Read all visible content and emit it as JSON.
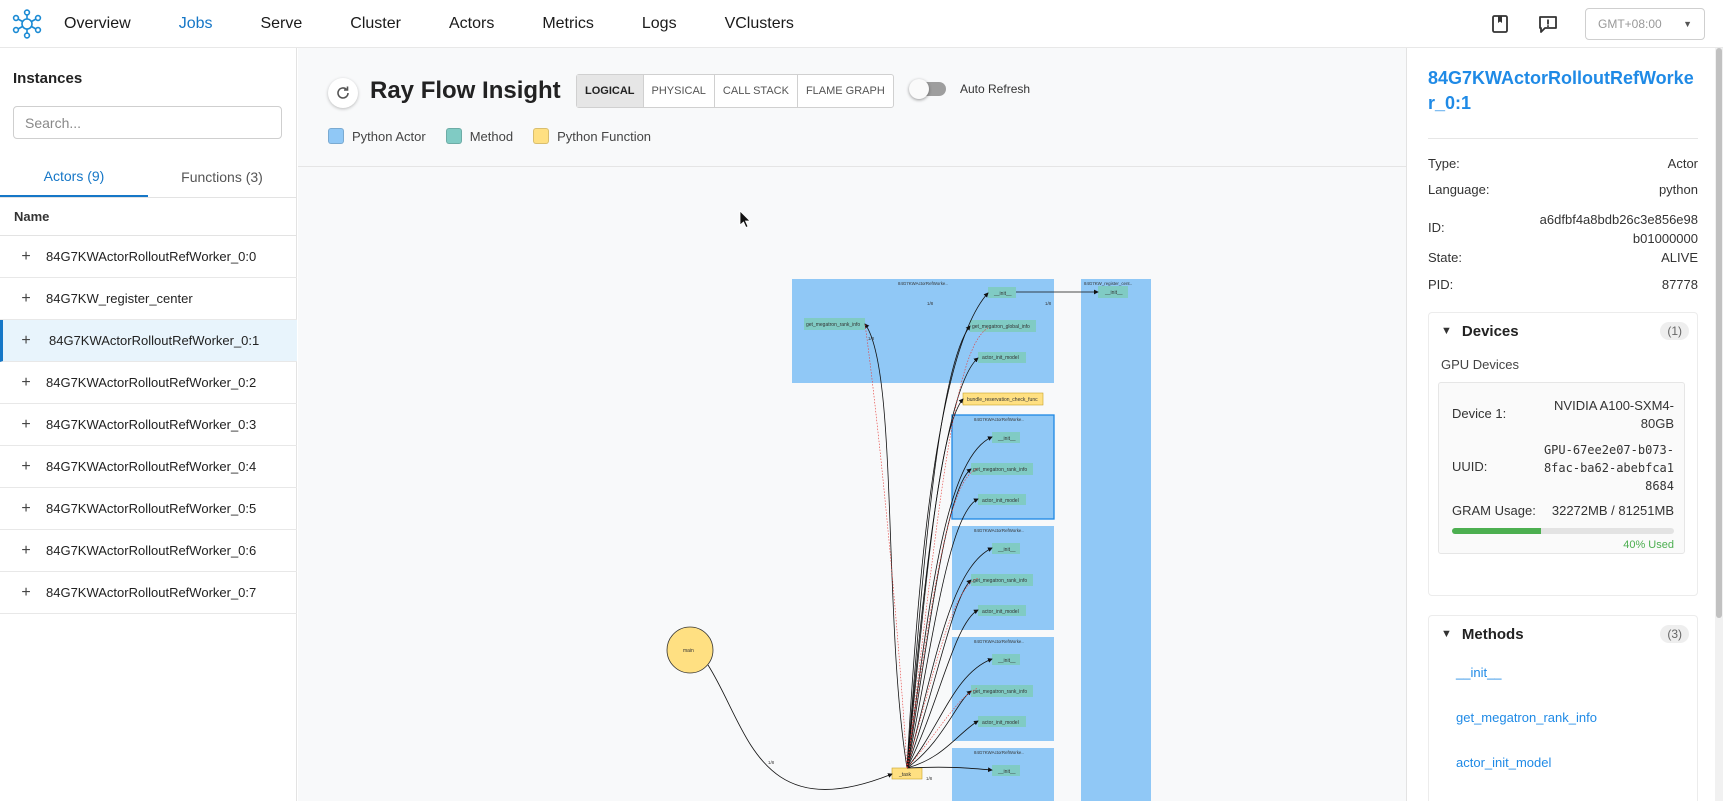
{
  "nav": {
    "items": [
      "Overview",
      "Jobs",
      "Serve",
      "Cluster",
      "Actors",
      "Metrics",
      "Logs",
      "VClusters"
    ],
    "active": "Jobs",
    "timezone": "GMT+08:00"
  },
  "sidebar": {
    "title": "Instances",
    "search_placeholder": "Search...",
    "tabs": [
      "Actors (9)",
      "Functions (3)"
    ],
    "column_header": "Name",
    "items": [
      "84G7KWActorRolloutRefWorker_0:0",
      "84G7KW_register_center",
      "84G7KWActorRolloutRefWorker_0:1",
      "84G7KWActorRolloutRefWorker_0:2",
      "84G7KWActorRolloutRefWorker_0:3",
      "84G7KWActorRolloutRefWorker_0:4",
      "84G7KWActorRolloutRefWorker_0:5",
      "84G7KWActorRolloutRefWorker_0:6",
      "84G7KWActorRolloutRefWorker_0:7"
    ],
    "selected_index": 2
  },
  "main": {
    "title": "Ray Flow Insight",
    "views": [
      "LOGICAL",
      "PHYSICAL",
      "CALL STACK",
      "FLAME GRAPH"
    ],
    "active_view": "LOGICAL",
    "auto_refresh_label": "Auto Refresh",
    "legend": [
      {
        "label": "Python Actor",
        "color": "#90c8f6"
      },
      {
        "label": "Method",
        "color": "#80cbc4"
      },
      {
        "label": "Python Function",
        "color": "#ffe082"
      }
    ]
  },
  "graph": {
    "main_node": "main",
    "actor_top_label": "84G7KWActorRefWorke..",
    "register_label": "84G7KW_register_cent..",
    "actor_label": "84G7KWActorRefWorke..",
    "methods_top": [
      "get_megatron_rank_info",
      "__init__",
      "get_megatron_global_info",
      "actor_init_model"
    ],
    "register_method": "__init__",
    "bundle_fn": "bundle_reservation_check_func",
    "actor_methods": [
      "__init__",
      "get_megatron_rank_info",
      "actor_init_model"
    ],
    "task_fn": "_task",
    "edge_label": "1/8"
  },
  "detail": {
    "title": "84G7KWActorRolloutRefWorker_0:1",
    "type_label": "Type:",
    "type": "Actor",
    "language_label": "Language:",
    "language": "python",
    "id_label": "ID:",
    "id": "a6dfbf4a8bdb26c3e856e98b01000000",
    "state_label": "State:",
    "state": "ALIVE",
    "pid_label": "PID:",
    "pid": "87778",
    "devices": {
      "title": "Devices",
      "count": "(1)",
      "section": "GPU Devices",
      "device_label": "Device 1:",
      "device": "NVIDIA A100-SXM4-80GB",
      "uuid_label": "UUID:",
      "uuid": "GPU-67ee2e07-b073-8fac-ba62-abebfca18684",
      "gram_label": "GRAM Usage:",
      "gram": "32272MB / 81251MB",
      "used_fraction": 0.4,
      "used_text": "40% Used"
    },
    "methods": {
      "title": "Methods",
      "count": "(3)",
      "items": [
        "__init__",
        "get_megatron_rank_info",
        "actor_init_model"
      ]
    }
  }
}
